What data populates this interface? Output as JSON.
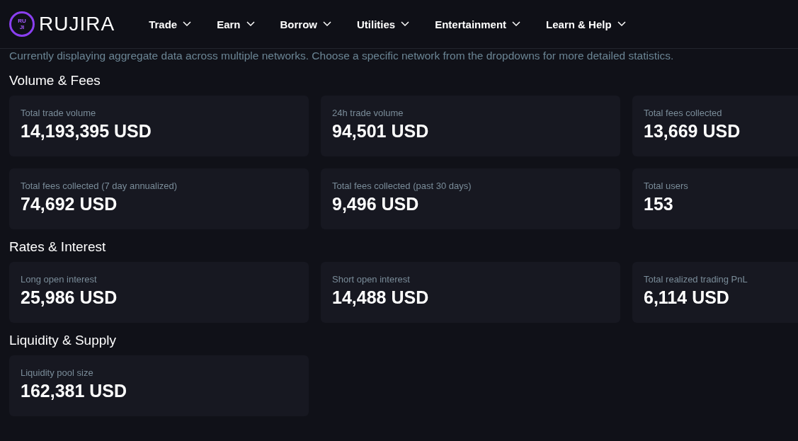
{
  "logo": {
    "badge": [
      "RU",
      "JI"
    ],
    "name": "RUJIRA"
  },
  "nav": [
    {
      "label": "Trade"
    },
    {
      "label": "Earn"
    },
    {
      "label": "Borrow"
    },
    {
      "label": "Utilities"
    },
    {
      "label": "Entertainment"
    },
    {
      "label": "Learn & Help"
    }
  ],
  "notice": "Currently displaying aggregate data across multiple networks. Choose a specific network from the dropdowns for more detailed statistics.",
  "sections": [
    {
      "title": "Volume & Fees",
      "cards": [
        {
          "label": "Total trade volume",
          "value": "14,193,395 USD"
        },
        {
          "label": "24h trade volume",
          "value": "94,501 USD"
        },
        {
          "label": "Total fees collected",
          "value": "13,669 USD"
        },
        {
          "label": "Total fees collected (7 day annualized)",
          "value": "74,692 USD"
        },
        {
          "label": "Total fees collected (past 30 days)",
          "value": "9,496 USD"
        },
        {
          "label": "Total users",
          "value": "153"
        }
      ]
    },
    {
      "title": "Rates & Interest",
      "cards": [
        {
          "label": "Long open interest",
          "value": "25,986 USD"
        },
        {
          "label": "Short open interest",
          "value": "14,488 USD"
        },
        {
          "label": "Total realized trading PnL",
          "value": "6,114 USD"
        }
      ]
    },
    {
      "title": "Liquidity & Supply",
      "cards": [
        {
          "label": "Liquidity pool size",
          "value": "162,381 USD"
        }
      ]
    }
  ]
}
